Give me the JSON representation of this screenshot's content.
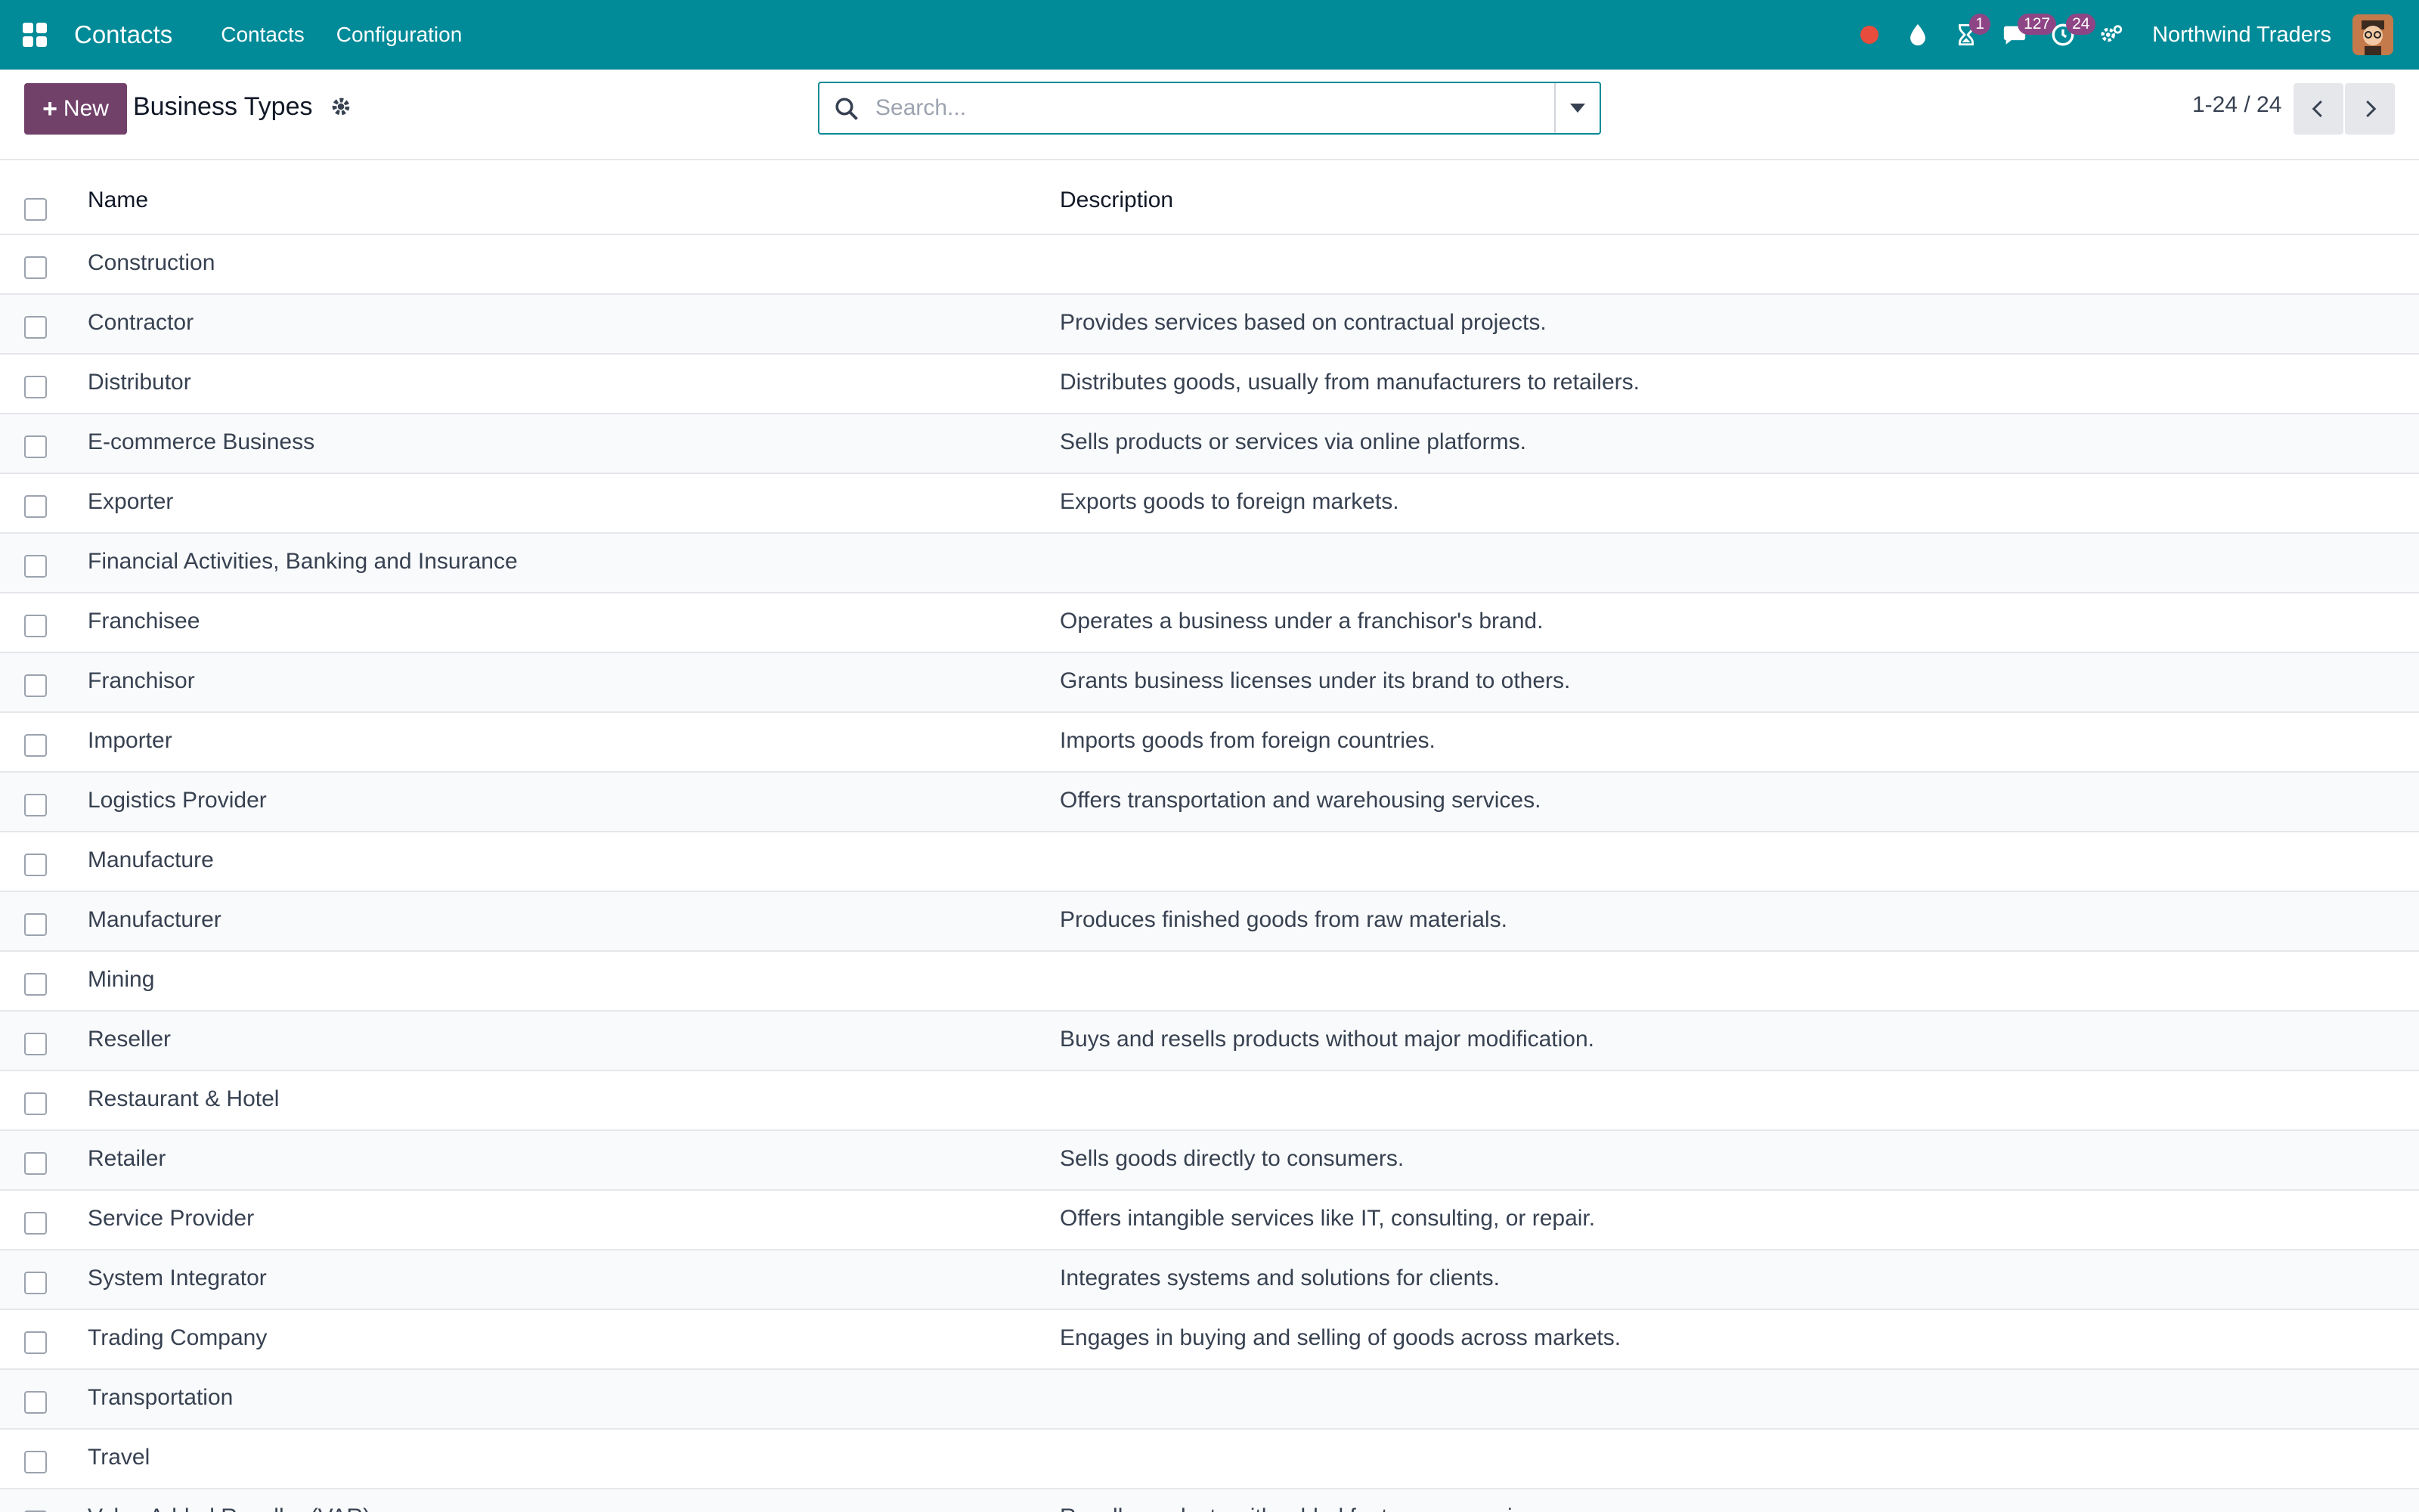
{
  "navbar": {
    "app_name": "Contacts",
    "menu": [
      "Contacts",
      "Configuration"
    ],
    "badges": {
      "activities": "1",
      "messages": "127",
      "updates": "24"
    },
    "company": "Northwind Traders",
    "icons": [
      "apps-grid-icon",
      "recording-dot-icon",
      "droplet-icon",
      "hourglass-icon",
      "chat-icon",
      "clock-icon",
      "settings-icon"
    ]
  },
  "control": {
    "new_label": "New",
    "title": "Business Types",
    "search_placeholder": "Search...",
    "pager": "1-24 / 24"
  },
  "table": {
    "columns": [
      "Name",
      "Description"
    ],
    "rows": [
      {
        "name": "Construction",
        "description": ""
      },
      {
        "name": "Contractor",
        "description": "Provides services based on contractual projects."
      },
      {
        "name": "Distributor",
        "description": "Distributes goods, usually from manufacturers to retailers."
      },
      {
        "name": "E-commerce Business",
        "description": "Sells products or services via online platforms."
      },
      {
        "name": "Exporter",
        "description": "Exports goods to foreign markets."
      },
      {
        "name": "Financial Activities, Banking and Insurance",
        "description": ""
      },
      {
        "name": "Franchisee",
        "description": "Operates a business under a franchisor's brand."
      },
      {
        "name": "Franchisor",
        "description": "Grants business licenses under its brand to others."
      },
      {
        "name": "Importer",
        "description": "Imports goods from foreign countries."
      },
      {
        "name": "Logistics Provider",
        "description": "Offers transportation and warehousing services."
      },
      {
        "name": "Manufacture",
        "description": ""
      },
      {
        "name": "Manufacturer",
        "description": "Produces finished goods from raw materials."
      },
      {
        "name": "Mining",
        "description": ""
      },
      {
        "name": "Reseller",
        "description": "Buys and resells products without major modification."
      },
      {
        "name": "Restaurant & Hotel",
        "description": ""
      },
      {
        "name": "Retailer",
        "description": "Sells goods directly to consumers."
      },
      {
        "name": "Service Provider",
        "description": "Offers intangible services like IT, consulting, or repair."
      },
      {
        "name": "System Integrator",
        "description": "Integrates systems and solutions for clients."
      },
      {
        "name": "Trading Company",
        "description": "Engages in buying and selling of goods across markets."
      },
      {
        "name": "Transportation",
        "description": ""
      },
      {
        "name": "Travel",
        "description": ""
      },
      {
        "name": "Value Added Reseller (VAR)",
        "description": "Resells products with added features or services."
      }
    ]
  },
  "colors": {
    "navbar": "#018a98",
    "primary_button": "#71416a",
    "badge": "#8e4585",
    "record": "#e74c3c"
  }
}
